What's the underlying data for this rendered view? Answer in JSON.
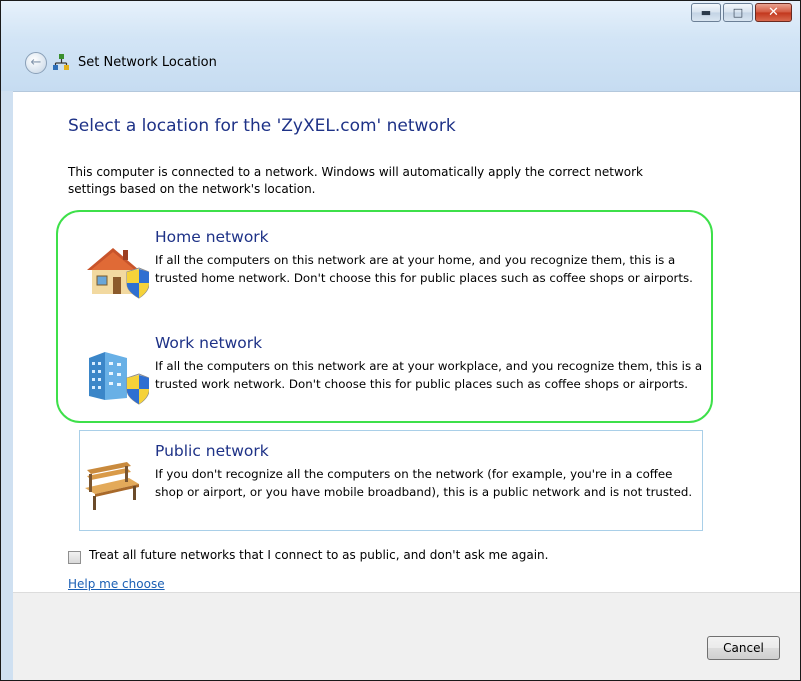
{
  "window": {
    "title": "Set Network Location",
    "caption_buttons": {
      "minimize": "minimize",
      "maximize": "maximize",
      "close": "close"
    }
  },
  "heading": "Select a location for the 'ZyXEL.com' network",
  "intro": "This computer is connected to a network. Windows will automatically apply the correct network settings based on the network's location.",
  "options": [
    {
      "title": "Home network",
      "description": "If all the computers on this network are at your home, and you recognize them, this is a trusted home network.  Don't choose this for public places such as coffee shops or airports.",
      "icon": "home-network-icon"
    },
    {
      "title": "Work network",
      "description": "If all the computers on this network are at your workplace, and you recognize them, this is a trusted work network.  Don't choose this for public places such as coffee shops or airports.",
      "icon": "work-network-icon"
    },
    {
      "title": "Public network",
      "description": "If you don't recognize all the computers on the network (for example, you're in a coffee shop or airport, or you have mobile broadband), this is a public network and is not trusted.",
      "icon": "public-network-bench-icon"
    }
  ],
  "treat_public_checkbox": {
    "label": "Treat all future networks that I connect to as public, and don't ask me again.",
    "checked": false
  },
  "help_link": "Help me choose",
  "cancel_label": "Cancel",
  "colors": {
    "heading": "#1e3287",
    "highlight_border": "#3ee04a",
    "link": "#1a5fb4"
  }
}
